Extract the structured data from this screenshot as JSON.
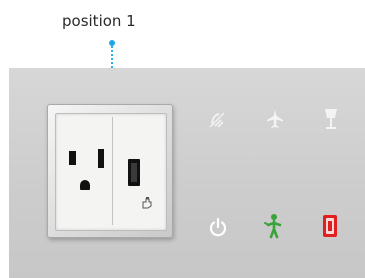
{
  "callout": {
    "label": "position 1"
  },
  "colors": {
    "callout": "#1ea9e6",
    "panel": "#cfcfcf",
    "power": "#ffffff",
    "person": "#3aa43a",
    "alert": "#e02020"
  },
  "icons": {
    "top_row": [
      "no-power-icon",
      "airplane-icon",
      "lamp-icon"
    ],
    "bottom_row": [
      "power-icon",
      "person-icon",
      "alert-icon"
    ]
  }
}
